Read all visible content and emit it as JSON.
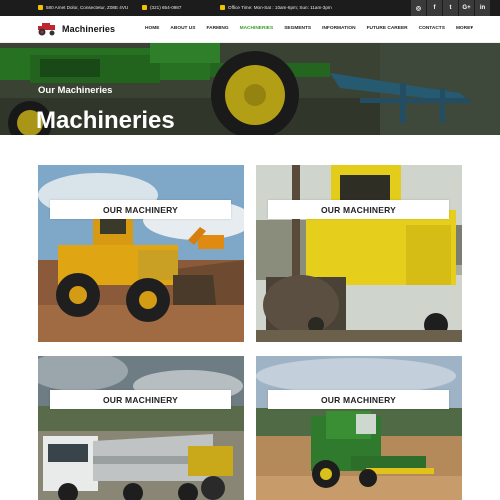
{
  "topbar": {
    "address": "580 Amet Dolor, Consectetur, Z08E 4VU",
    "phone": "(321) 654-0987",
    "hours": "Office Time: Mon-Sat : 10am-6pm; Sun: 11am-3pm",
    "social": [
      {
        "icon": "rss-icon",
        "glyph": "◎"
      },
      {
        "icon": "facebook-icon",
        "glyph": "f"
      },
      {
        "icon": "twitter-icon",
        "glyph": "t"
      },
      {
        "icon": "google-plus-icon",
        "glyph": "G+"
      },
      {
        "icon": "linkedin-icon",
        "glyph": "in"
      }
    ]
  },
  "header": {
    "brand": "Machineries",
    "nav": [
      {
        "label": "HOME",
        "active": false
      },
      {
        "label": "ABOUT US",
        "active": false
      },
      {
        "label": "FARMING",
        "active": false
      },
      {
        "label": "MACHINERIES",
        "active": true
      },
      {
        "label": "SEGMENTS",
        "active": false
      },
      {
        "label": "INFORMATION",
        "active": false
      },
      {
        "label": "FUTURE CAREER",
        "active": false
      },
      {
        "label": "CONTACTS",
        "active": false
      },
      {
        "label": "MORE▾",
        "active": false
      }
    ]
  },
  "hero": {
    "subtitle": "Our Machineries",
    "title": "Machineries"
  },
  "cards": [
    {
      "label": "OUR MACHINERY"
    },
    {
      "label": "OUR MACHINERY"
    },
    {
      "label": "OUR MACHINERY"
    },
    {
      "label": "OUR MACHINERY"
    }
  ],
  "colors": {
    "accent": "#3c9b2e",
    "topbar": "#1c1c1c",
    "icon_yellow": "#f2c200"
  }
}
